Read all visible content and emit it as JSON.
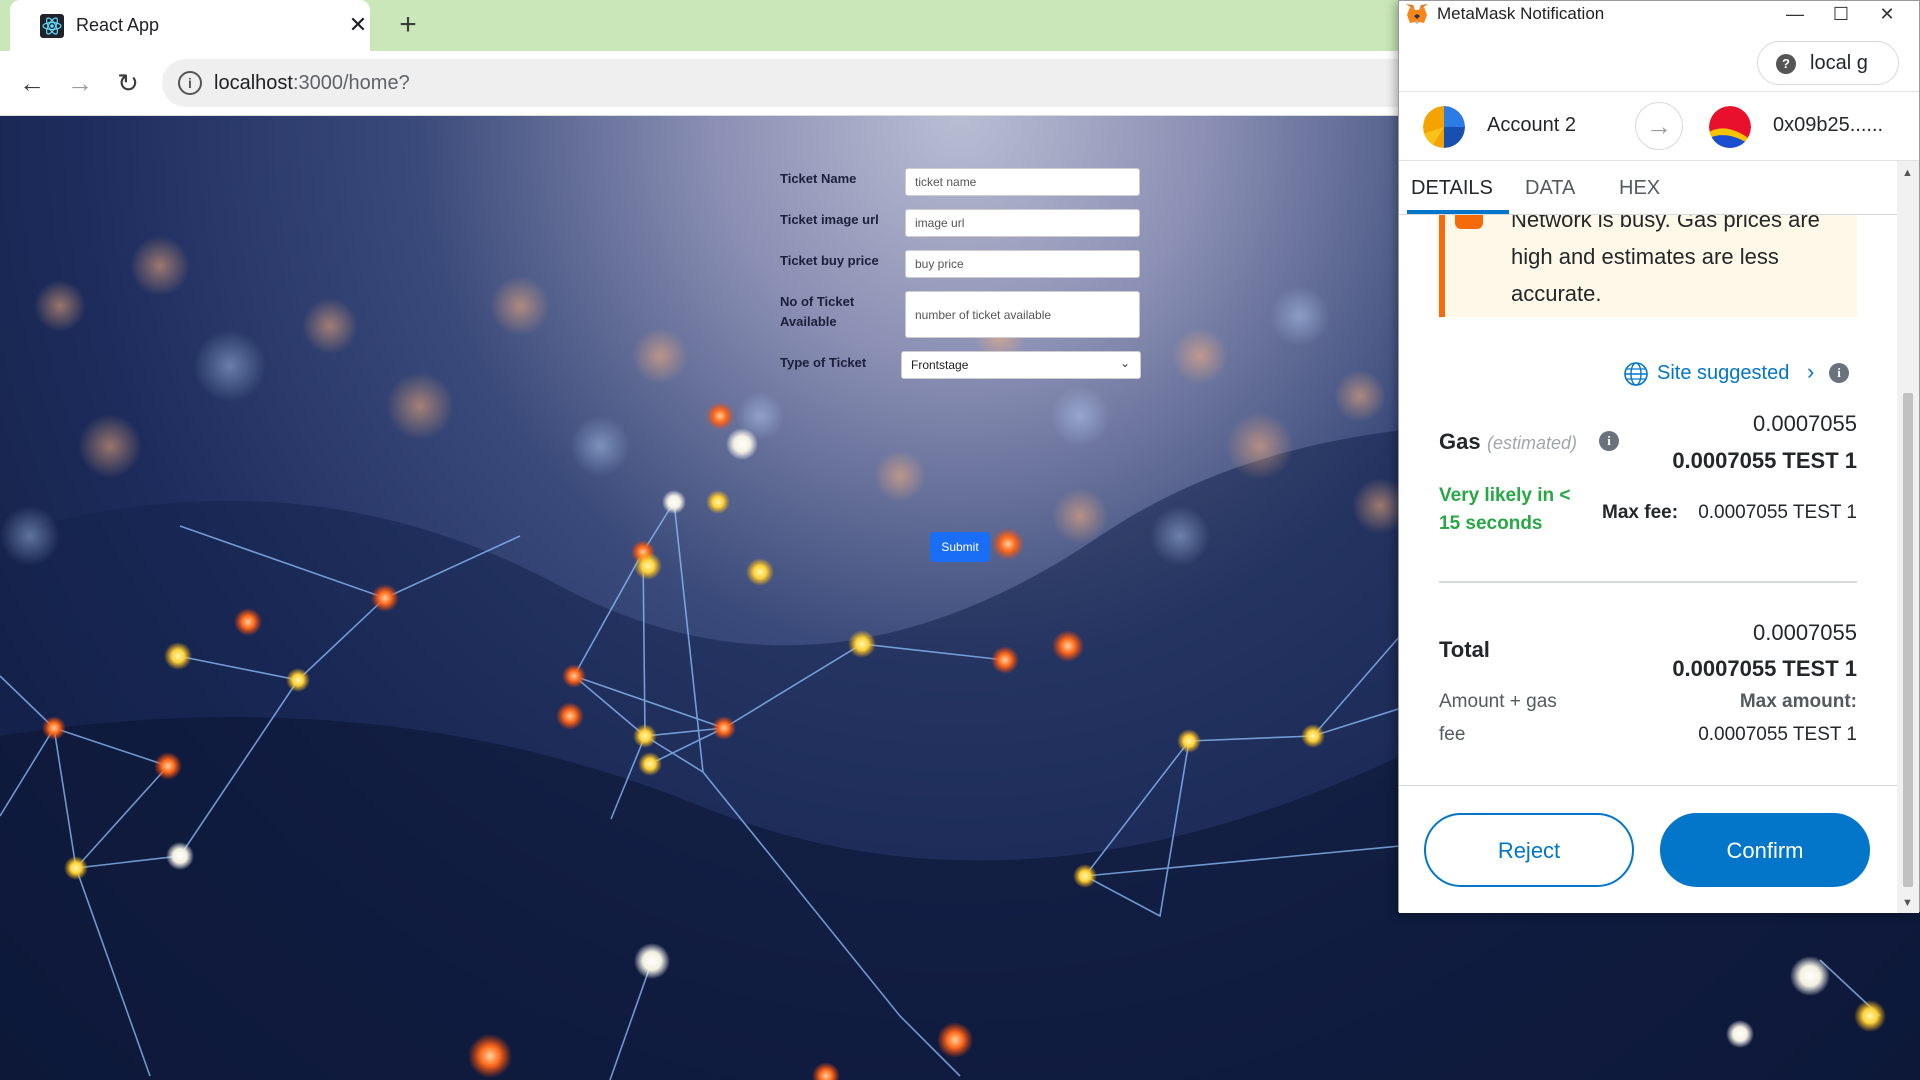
{
  "browser": {
    "tab_title": "React App",
    "tab_close": "✕",
    "new_tab": "+",
    "url_host": "localhost",
    "url_path": ":3000/home?",
    "nav_back": "←",
    "nav_forward": "→",
    "nav_reload": "↻"
  },
  "form": {
    "ticket_name_label": "Ticket Name",
    "ticket_name_placeholder": "ticket name",
    "image_url_label": "Ticket image url",
    "image_url_placeholder": "image url",
    "buy_price_label": "Ticket buy price",
    "buy_price_placeholder": "buy price",
    "available_label_line1": "No of Ticket",
    "available_label_line2": "Available",
    "available_placeholder": "number of ticket available",
    "type_label": "Type of Ticket",
    "type_selected": "Frontstage",
    "submit_label": "Submit"
  },
  "metamask": {
    "window_title": "MetaMask Notification",
    "window_minimize": "—",
    "window_maximize": "☐",
    "window_close": "✕",
    "network_label": "local g",
    "network_help": "?",
    "from_account": "Account 2",
    "to_address": "0x09b25......",
    "tabs": [
      "DETAILS",
      "DATA",
      "HEX"
    ],
    "warning_text": "Network is busy. Gas prices are high and estimates are less accurate.",
    "site_suggested": "Site suggested",
    "gas_label": "Gas",
    "gas_estimated": "(estimated)",
    "gas_value": "0.0007055",
    "gas_value_token": "0.0007055 TEST 1",
    "likely_line1": "Very likely in <",
    "likely_line2": "15 seconds",
    "max_fee_label": "Max fee:",
    "max_fee_value": "0.0007055 TEST 1",
    "total_label": "Total",
    "total_value": "0.0007055",
    "total_value_token": "0.0007055 TEST 1",
    "amount_gas_line1": "Amount + gas",
    "amount_gas_line2": "fee",
    "max_amount_label": "Max amount:",
    "max_amount_value": "0.0007055 TEST 1",
    "reject_label": "Reject",
    "confirm_label": "Confirm"
  },
  "colors": {
    "metamask_blue": "#0376c9",
    "success_green": "#28a745",
    "warning_orange": "#f66a0a",
    "submit_blue": "#1a6ef5",
    "tabstrip_green": "#c9e7b8"
  }
}
